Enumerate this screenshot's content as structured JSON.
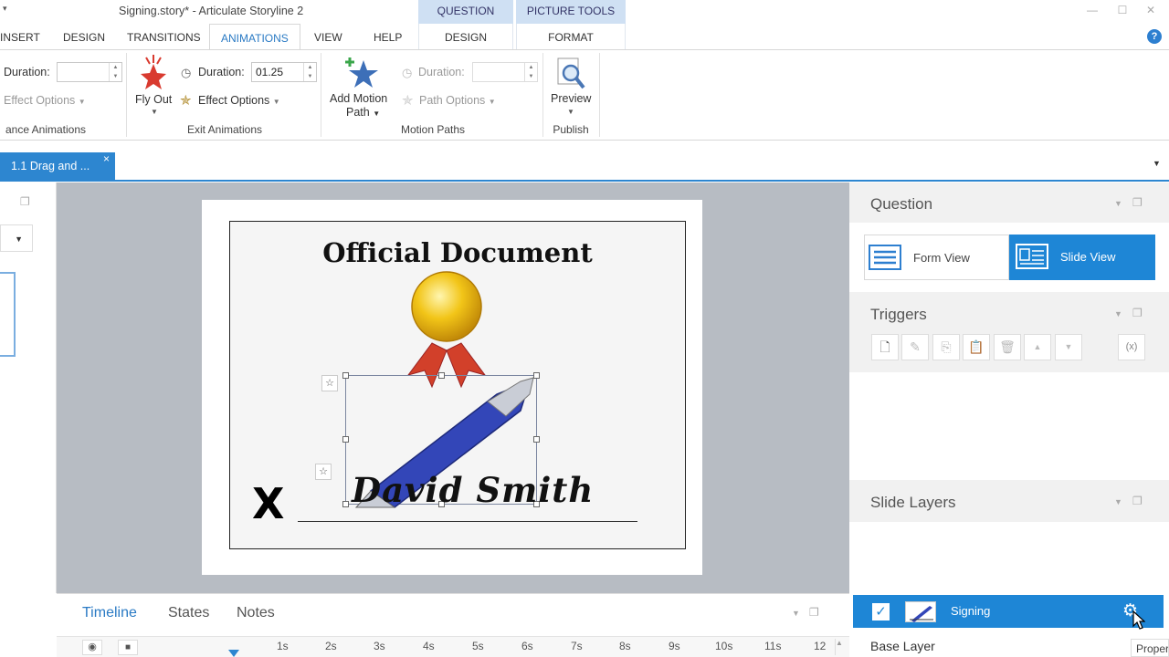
{
  "window": {
    "title": "Signing.story* -  Articulate Storyline 2",
    "context_groups": [
      "QUESTION TOOLS",
      "PICTURE TOOLS"
    ]
  },
  "tabs": [
    "INSERT",
    "DESIGN",
    "TRANSITIONS",
    "ANIMATIONS",
    "VIEW",
    "HELP"
  ],
  "context_tabs": [
    "DESIGN",
    "FORMAT"
  ],
  "ribbon": {
    "entrance": {
      "duration_label": "Duration:",
      "duration_value": "",
      "effect_options": "Effect Options",
      "group_label": "ance Animations"
    },
    "exit": {
      "fly_out": "Fly Out",
      "duration_label": "Duration:",
      "duration_value": "01.25",
      "effect_options": "Effect Options",
      "group_label": "Exit Animations"
    },
    "motion": {
      "add_motion_line1": "Add Motion",
      "add_motion_line2": "Path",
      "duration_label": "Duration:",
      "duration_value": "",
      "path_options": "Path Options",
      "group_label": "Motion Paths"
    },
    "publish": {
      "preview": "Preview",
      "group_label": "Publish"
    }
  },
  "document_tab": {
    "label": "1.1 Drag and ...",
    "close": "×"
  },
  "slide": {
    "title": "Official Document",
    "signature": "David Smith",
    "x_mark": "X"
  },
  "timeline_tabs": [
    "Timeline",
    "States",
    "Notes"
  ],
  "timeline_ticks": [
    "1s",
    "2s",
    "3s",
    "4s",
    "5s",
    "6s",
    "7s",
    "8s",
    "9s",
    "10s",
    "11s",
    "12"
  ],
  "panels": {
    "question": {
      "title": "Question",
      "form_view": "Form View",
      "slide_view": "Slide View"
    },
    "triggers": {
      "title": "Triggers"
    },
    "slide_layers": {
      "title": "Slide Layers",
      "layer_name": "Signing",
      "base_layer": "Base Layer",
      "properties": "Proper"
    }
  },
  "colors": {
    "accent": "#1e86d6",
    "ribbon_text": "#333333"
  }
}
